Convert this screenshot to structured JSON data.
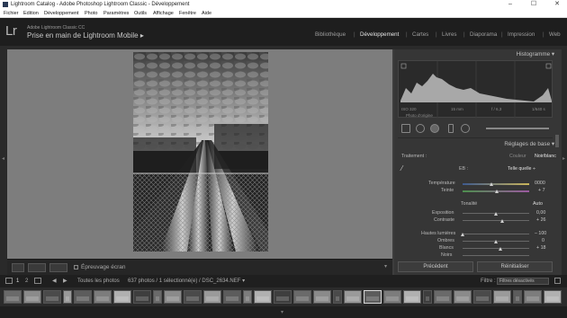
{
  "window": {
    "title": "Lightroom Catalog - Adobe Photoshop Lightroom Classic - Développement",
    "controls": [
      "–",
      "☐",
      "✕"
    ]
  },
  "menu": [
    "Fichier",
    "Edition",
    "Développement",
    "Photo",
    "Paramètres",
    "Outils",
    "Affichage",
    "Fenêtre",
    "Aide"
  ],
  "identity": {
    "logo": "Lr",
    "subtitle": "Adobe Lightroom Classic CC",
    "catalog": "Prise en main de Lightroom Mobile ▸"
  },
  "modules": [
    {
      "label": "Bibliothèque",
      "active": false
    },
    {
      "label": "Développement",
      "active": true
    },
    {
      "label": "Cartes",
      "active": false
    },
    {
      "label": "Livres",
      "active": false
    },
    {
      "label": "Diaporama",
      "active": false
    },
    {
      "label": "Impression",
      "active": false
    },
    {
      "label": "Web",
      "active": false
    }
  ],
  "toolbar": {
    "proof_label": "Épreuvage écran"
  },
  "histogram": {
    "header": "Histogramme ▾",
    "iso": "ISO 320",
    "focal": "15 mm",
    "aperture": "f / 6,3",
    "shutter": "1/640 s",
    "original_photo": "Photo d'origine"
  },
  "basic": {
    "header": "Réglages de base ▾",
    "treatment_label": "Traitement :",
    "treatment_color": "Couleur",
    "treatment_bw": "Noir/blanc",
    "profile_label": "EB :",
    "profile_value": "Telle quelle ÷",
    "temperature": {
      "label": "Température",
      "value": "0000"
    },
    "tint": {
      "label": "Teinte",
      "value": "+ 7"
    },
    "tonality": "Tonalité",
    "auto": "Auto",
    "exposure": {
      "label": "Exposition",
      "value": "0,00"
    },
    "contrast": {
      "label": "Contraste",
      "value": "+ 26"
    },
    "highlights": {
      "label": "Hautes lumières",
      "value": "– 100"
    },
    "shadows": {
      "label": "Ombres",
      "value": "0"
    },
    "whites": {
      "label": "Blancs",
      "value": "+ 18"
    },
    "blacks": {
      "label": "Noirs",
      "value": ""
    }
  },
  "buttons": {
    "previous": "Précédent",
    "reset": "Réinitialiser"
  },
  "filmstrip_bar": {
    "page1": "1",
    "page2": "2",
    "source": "Toutes les photos",
    "info": "637 photos / 1 sélectionné(e) / DSC_2634.NEF ▾",
    "filter_label": "Filtre :",
    "filter_value": "Filtres désactivés"
  },
  "colors": {
    "accent": "#e6e6e6",
    "panel": "#363636",
    "canvas": "#7d7d7d"
  }
}
